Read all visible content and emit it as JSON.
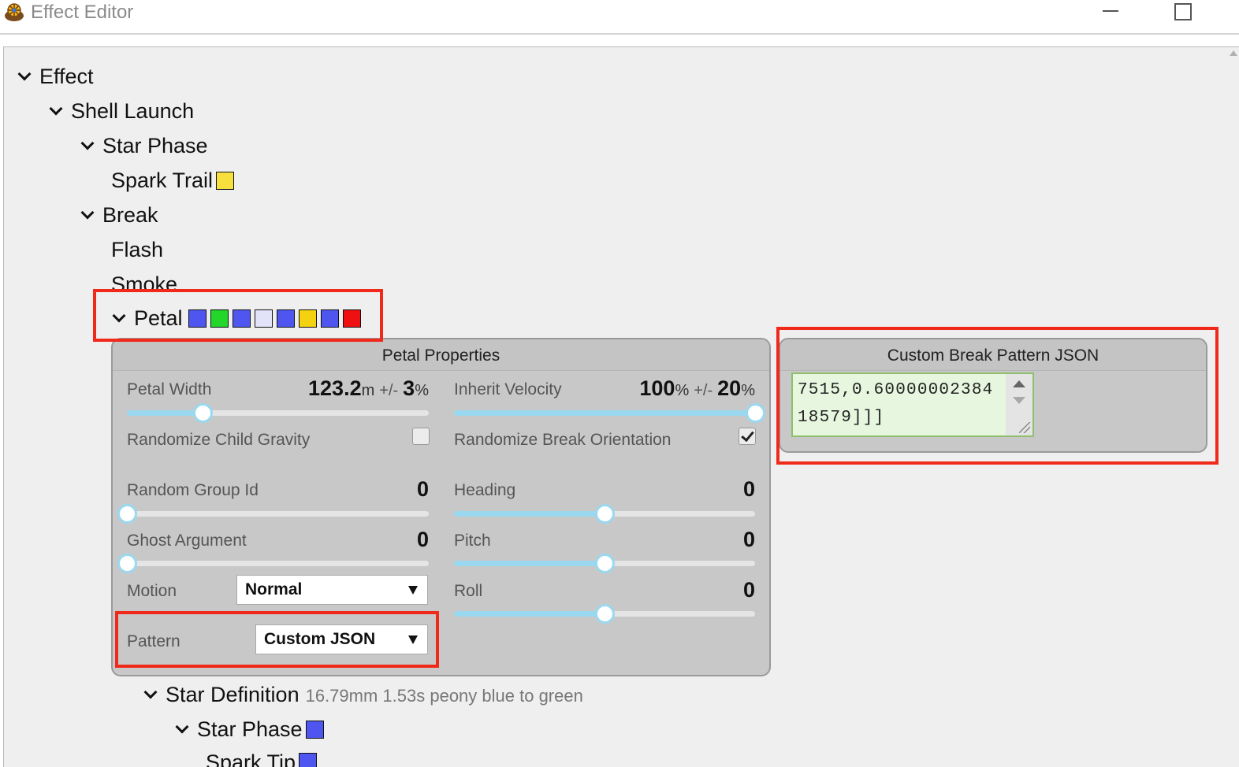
{
  "window": {
    "title": "Effect Editor",
    "icon": "firework-app-icon"
  },
  "tree": {
    "effect": "Effect",
    "shell_launch": "Shell Launch",
    "star_phase": "Star Phase",
    "spark_trail": "Spark Trail",
    "break": "Break",
    "flash": "Flash",
    "smoke": "Smoke",
    "petal": "Petal",
    "star_definition": "Star Definition",
    "star_definition_desc": "16.79mm 1.53s peony blue to green",
    "star_phase_2": "Star Phase",
    "spark_tip": "Spark Tip"
  },
  "colors": {
    "spark_trail": "#f7df3e",
    "petal_swatches": [
      "#4f56f0",
      "#22d62a",
      "#4f56f0",
      "#e2e2f8",
      "#4f56f0",
      "#f5d20f",
      "#4f56f0",
      "#ef1111"
    ],
    "star_phase_2": "#4f56f0",
    "spark_tip": "#4f56f0",
    "highlight": "#f02a1b",
    "slider": "#9ad8ef"
  },
  "petal_properties": {
    "title": "Petal Properties",
    "petal_width": {
      "label": "Petal Width",
      "value": "123.2",
      "unit": "m",
      "pm": "+/-",
      "variance": "3",
      "variance_unit": "%",
      "level": 0.25
    },
    "inherit_velocity": {
      "label": "Inherit Velocity",
      "value": "100",
      "unit": "%",
      "pm": "+/-",
      "variance": "20",
      "variance_unit": "%",
      "level": 1.0
    },
    "randomize_child_gravity": {
      "label": "Randomize Child Gravity",
      "checked": false
    },
    "randomize_break_orientation": {
      "label": "Randomize Break Orientation",
      "checked": true
    },
    "random_group_id": {
      "label": "Random Group Id",
      "value": "0",
      "level": 0.0
    },
    "heading": {
      "label": "Heading",
      "value": "0",
      "level": 0.5
    },
    "ghost_argument": {
      "label": "Ghost Argument",
      "value": "0",
      "level": 0.0
    },
    "pitch": {
      "label": "Pitch",
      "value": "0",
      "level": 0.5
    },
    "motion": {
      "label": "Motion",
      "selected": "Normal"
    },
    "roll": {
      "label": "Roll",
      "value": "0",
      "level": 0.5
    },
    "pattern": {
      "label": "Pattern",
      "selected": "Custom JSON"
    }
  },
  "custom_break_pattern": {
    "title": "Custom Break Pattern JSON",
    "line1": "7515,0.60000002384",
    "line2": "18579]]]"
  }
}
